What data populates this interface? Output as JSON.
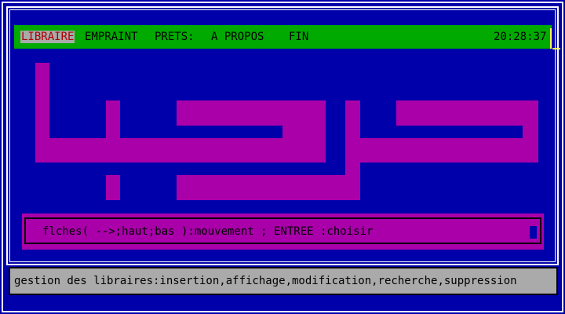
{
  "menu": {
    "items": [
      "LIBRAIRE",
      "EMPRAINT",
      "PRETS:",
      "A PROPOS",
      "FIN"
    ],
    "selected": "LIBRAIRE",
    "clock": "20:28:37"
  },
  "help": {
    "text": "flches( -->;haut;bas ):mouvement ; ENTREE :choisir"
  },
  "status": {
    "text": "gestion des libraires:insertion,affichage,modification,recherche,suppression"
  },
  "colors": {
    "background": "#0000AA",
    "menubar": "#00AA00",
    "selected_bg": "#AAAAAA",
    "selected_fg": "#AA0000",
    "banner": "#AA00AA",
    "status_bg": "#AAAAAA"
  }
}
